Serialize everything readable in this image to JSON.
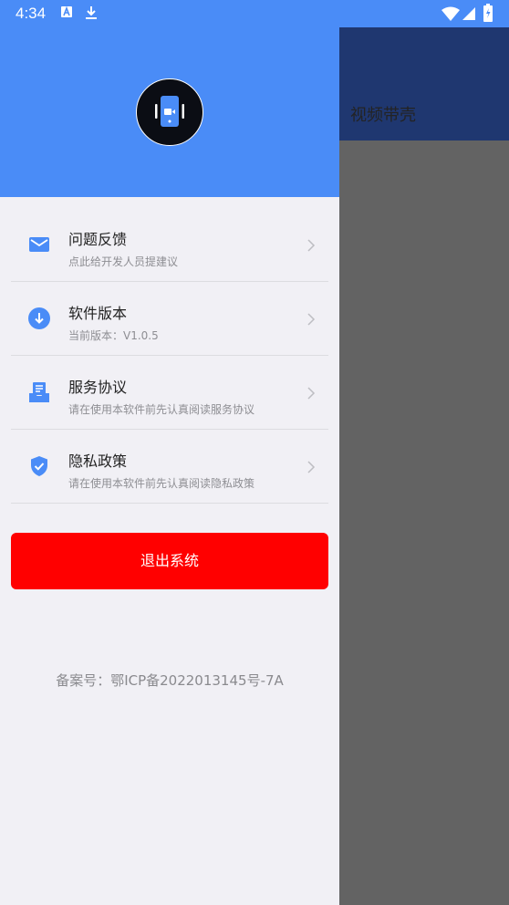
{
  "status_bar": {
    "time": "4:34"
  },
  "background_page": {
    "title": "视频带壳",
    "header_color": "#1f3770",
    "overlay_color": "#636363"
  },
  "drawer": {
    "header_color": "#4a8cf7",
    "menu": [
      {
        "title": "问题反馈",
        "subtitle": "点此给开发人员提建议",
        "icon": "mail-icon"
      },
      {
        "title": "软件版本",
        "subtitle": "当前版本：V1.0.5",
        "icon": "download-circle-icon"
      },
      {
        "title": "服务协议",
        "subtitle": "请在使用本软件前先认真阅读服务协议",
        "icon": "document-tray-icon"
      },
      {
        "title": "隐私政策",
        "subtitle": "请在使用本软件前先认真阅读隐私政策",
        "icon": "shield-check-icon"
      }
    ],
    "logout_label": "退出系统",
    "icp": "备案号：鄂ICP备2022013145号-7A",
    "accent_color": "#4a8cf7",
    "danger_color": "#ff0000"
  }
}
